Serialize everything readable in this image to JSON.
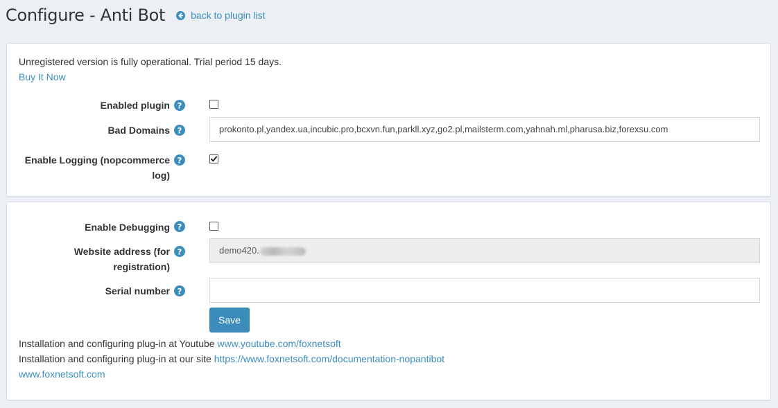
{
  "header": {
    "title": "Configure - Anti Bot",
    "back_link": "back to plugin list"
  },
  "license": {
    "notice": "Unregistered version is fully operational. Trial period 15 days.",
    "buy_link": "Buy It Now"
  },
  "settings": {
    "enabled_plugin": {
      "label": "Enabled plugin",
      "checked": false
    },
    "bad_domains": {
      "label": "Bad Domains",
      "value": "prokonto.pl,yandex.ua,incubic.pro,bcxvn.fun,parkll.xyz,go2.pl,mailsterm.com,yahnah.ml,pharusa.biz,forexsu.com"
    },
    "enable_logging": {
      "label_line1": "Enable Logging (nopcommerce",
      "label_line2": "log)",
      "checked": true
    }
  },
  "registration": {
    "enable_debugging": {
      "label": "Enable Debugging",
      "checked": false
    },
    "website_address": {
      "label_line1": "Website address (for",
      "label_line2": "registration)",
      "value_visible": "demo420."
    },
    "serial_number": {
      "label": "Serial number",
      "value": ""
    },
    "save_label": "Save"
  },
  "footer": {
    "youtube_text": "Installation and configuring plug-in at Youtube",
    "youtube_link": "www.youtube.com/foxnetsoft",
    "site_text": "Installation and configuring plug-in at our site",
    "site_link": "https://www.foxnetsoft.com/documentation-nopantibot",
    "home_link": "www.foxnetsoft.com"
  },
  "colors": {
    "accent": "#3c8dbc",
    "background": "#ecf0f5",
    "panel": "#ffffff",
    "readonly_input": "#eeeeee"
  },
  "icons": {
    "back": "circle-arrow-left-icon",
    "help": "question-circle-icon",
    "check": "checkmark-icon"
  }
}
